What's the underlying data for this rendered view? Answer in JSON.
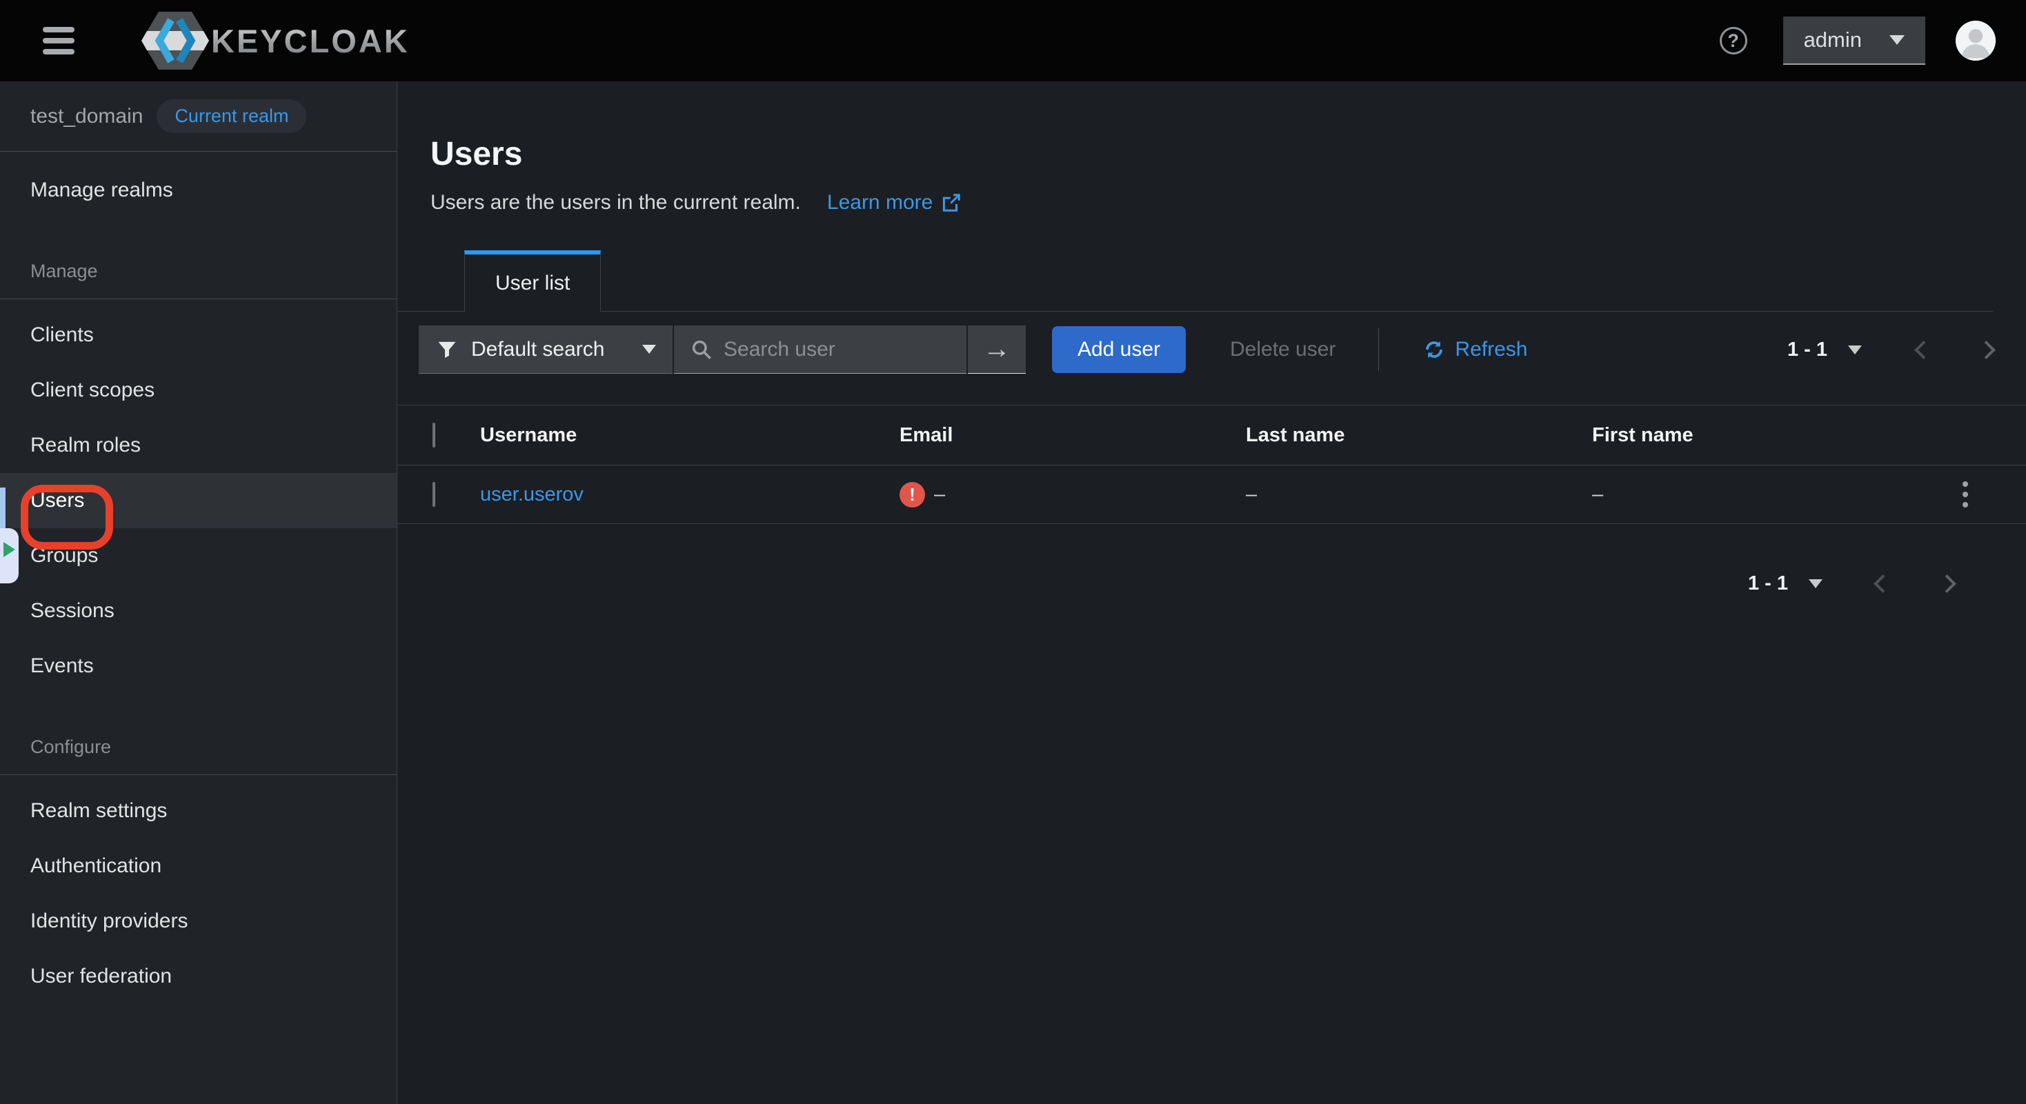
{
  "topbar": {
    "brand": "KEYCLOAK",
    "username": "admin"
  },
  "icons": {
    "help_glyph": "?",
    "arrow_right_glyph": "→",
    "error_glyph": "!"
  },
  "sidebar": {
    "realm_name": "test_domain",
    "realm_badge": "Current realm",
    "manage_realms": "Manage realms",
    "sections": [
      {
        "label": "Manage",
        "items": [
          "Clients",
          "Client scopes",
          "Realm roles",
          "Users",
          "Groups",
          "Sessions",
          "Events"
        ]
      },
      {
        "label": "Configure",
        "items": [
          "Realm settings",
          "Authentication",
          "Identity providers",
          "User federation"
        ]
      }
    ]
  },
  "main": {
    "title": "Users",
    "description": "Users are the users in the current realm.",
    "learn_more": "Learn more",
    "tab": "User list",
    "toolbar": {
      "filter_label": "Default search",
      "search_placeholder": "Search user",
      "add_button": "Add user",
      "delete_button": "Delete user",
      "refresh_label": "Refresh",
      "pagination": "1 - 1"
    },
    "table": {
      "headers": [
        "Username",
        "Email",
        "Last name",
        "First name"
      ],
      "row": {
        "username": "user.userov",
        "email": "–",
        "last_name": "–",
        "first_name": "–"
      }
    },
    "bottom_pagination": "1 - 1"
  },
  "colors": {
    "accent_blue": "#2b9af3",
    "link_blue": "#3b97e9",
    "primary_button": "#2d6ac9",
    "danger_red": "#e0564b",
    "annotation_red": "#e8402a",
    "topbar_bg": "#050505",
    "sidebar_bg": "#202327",
    "main_bg": "#1b1e22"
  }
}
